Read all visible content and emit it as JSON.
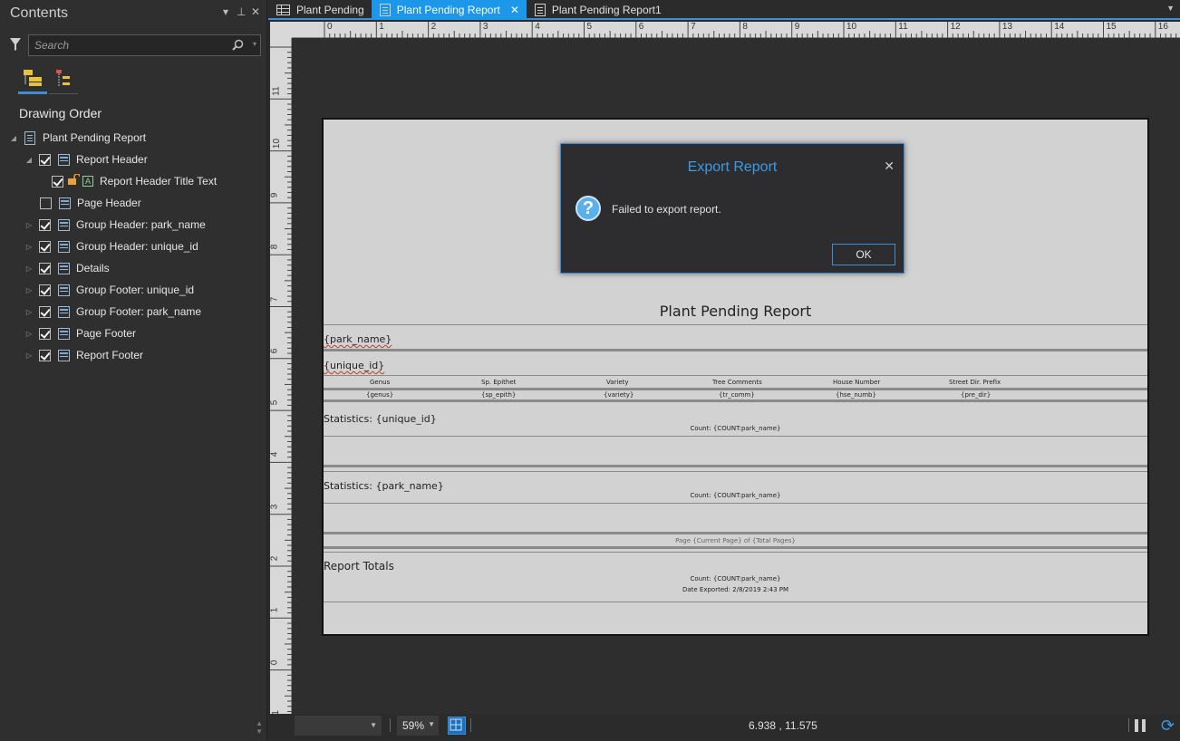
{
  "contents_pane": {
    "title": "Contents",
    "pin_glyph": "▾ ⊥",
    "close_glyph": "✕",
    "search_placeholder": "Search",
    "section_heading": "Drawing Order",
    "tree": {
      "root": "Plant Pending Report",
      "items": [
        {
          "label": "Report Header"
        },
        {
          "label": "Report Header Title Text"
        },
        {
          "label": "Page Header"
        },
        {
          "label": "Group Header: park_name"
        },
        {
          "label": "Group Header: unique_id"
        },
        {
          "label": "Details"
        },
        {
          "label": "Group Footer: unique_id"
        },
        {
          "label": "Group Footer: park_name"
        },
        {
          "label": "Page Footer"
        },
        {
          "label": "Report Footer"
        }
      ]
    }
  },
  "tabs": [
    {
      "label": "Plant Pending",
      "icon": "table-icon"
    },
    {
      "label": "Plant Pending Report",
      "icon": "report-icon",
      "close": "✕"
    },
    {
      "label": "Plant Pending Report1",
      "icon": "report-icon"
    }
  ],
  "ruler": {
    "h_labels": [
      "0",
      "1",
      "2",
      "3",
      "4",
      "5",
      "6",
      "7",
      "8",
      "9",
      "10",
      "11",
      "12",
      "13",
      "14",
      "15",
      "16"
    ],
    "v_labels": [
      "11",
      "10",
      "9",
      "8",
      "7",
      "6",
      "5",
      "4",
      "3",
      "2",
      "1",
      "0",
      "-1"
    ]
  },
  "report": {
    "title": "Plant Pending Report",
    "group_header_park": "{park_name}",
    "group_header_unique": "{unique_id}",
    "columns": [
      "Genus",
      "Sp. Epithet",
      "Variety",
      "Tree Comments",
      "House Number",
      "Street Dir. Prefix"
    ],
    "fields": [
      "{genus}",
      "{sp_epith}",
      "{variety}",
      "{tr_comm}",
      "{hse_numb}",
      "{pre_dir}"
    ],
    "stats_unique_label": "Statistics: {unique_id}",
    "stats_unique_count": "Count: {COUNT:park_name}",
    "stats_park_label": "Statistics: {park_name}",
    "stats_park_count": "Count: {COUNT:park_name}",
    "page_footer": "Page {Current Page} of {Total Pages}",
    "totals_label": "Report Totals",
    "totals_count": "Count: {COUNT:park_name}",
    "date_exported": "Date Exported: 2/8/2019 2:43 PM"
  },
  "dialog": {
    "title": "Export Report",
    "close_glyph": "✕",
    "icon_glyph": "?",
    "message": "Failed to export report.",
    "ok_label": "OK"
  },
  "status_bar": {
    "zoom": "59%",
    "coordinates": "6.938 , 11.575"
  },
  "colors": {
    "accent": "#3b8fd9",
    "active_tab": "#1c97ea",
    "page_bg": "#d2d2d2",
    "dialog_bg": "#2d2d30"
  }
}
